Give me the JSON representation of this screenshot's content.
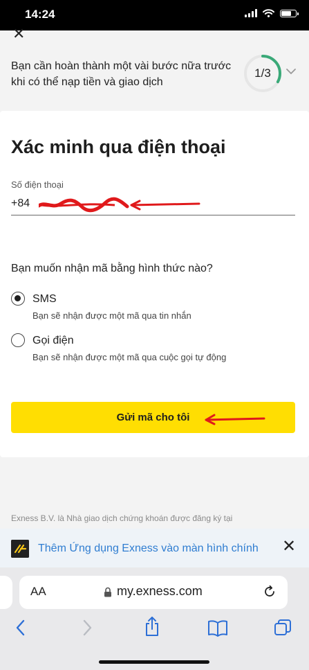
{
  "status_bar": {
    "time": "14:24"
  },
  "progress": {
    "message": "Bạn cần hoàn thành một vài bước nữa trước khi có thể nạp tiền và giao dịch",
    "step_label": "1/3",
    "fraction": 0.33,
    "ring_color": "#3aa978"
  },
  "form": {
    "title": "Xác minh qua điện thoại",
    "phone_label": "Số điện thoại",
    "phone_value": "+84",
    "question": "Bạn muốn nhận mã bằng hình thức nào?",
    "options": [
      {
        "label": "SMS",
        "description": "Bạn sẽ nhận được một mã qua tin nhắn",
        "selected": true
      },
      {
        "label": "Gọi điện",
        "description": "Bạn sẽ nhận được một mã qua cuộc gọi tự động",
        "selected": false
      }
    ],
    "submit_label": "Gửi mã cho tôi",
    "submit_color": "#ffde02"
  },
  "legal_text": "Exness B.V. là Nhà giao dịch chứng khoán được đăng ký tại",
  "app_banner": {
    "text": "Thêm Ứng dụng Exness vào màn hình chính",
    "text_color": "#2f7dd1"
  },
  "browser": {
    "text_size_label": "AA",
    "url": "my.exness.com",
    "nav_icons": [
      "back-icon",
      "forward-icon",
      "share-icon",
      "bookmarks-icon",
      "tabs-icon"
    ]
  }
}
